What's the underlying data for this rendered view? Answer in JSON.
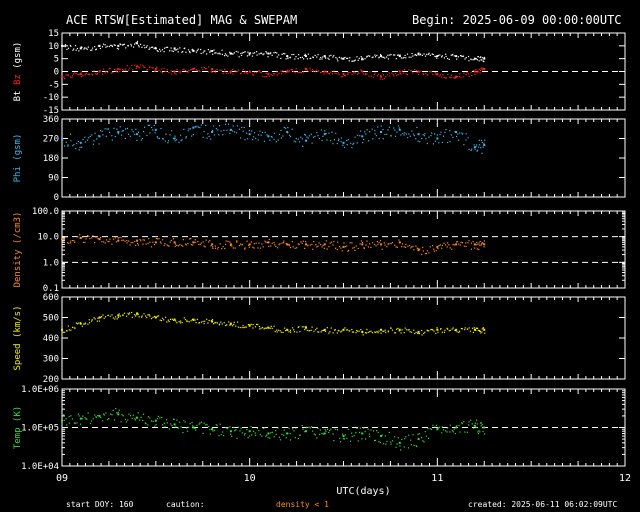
{
  "header": {
    "title": "ACE RTSW[Estimated] MAG & SWEPAM",
    "begin": "Begin: 2025-06-09 00:00:00UTC"
  },
  "footer": {
    "start_doy": "start DOY: 160",
    "caution": "caution:",
    "density_note": "density < 1",
    "created": "created: 2025-06-11 06:02:09UTC"
  },
  "colors": {
    "background": "#000000",
    "frame": "#ffffff",
    "bt": "#ffffff",
    "bz": "#ff2020",
    "phi": "#33bbee",
    "density": "#ff8c1a",
    "speed": "#f4f000",
    "temp": "#33dd33",
    "caution": "#ff8c1a"
  },
  "chart_data": [
    {
      "type": "scatter",
      "title": "ACE RTSW[Estimated] MAG & SWEPAM",
      "ylabel_parts": [
        "Bt",
        "Bz",
        "(gsm)"
      ],
      "ylim": [
        -15,
        15
      ],
      "yticks": [
        -15,
        -10,
        -5,
        0,
        5,
        10,
        15
      ],
      "yticklabels": [
        "-15",
        "-10",
        "-5",
        "0",
        "5",
        "10",
        "15"
      ],
      "reference_lines": [
        0
      ],
      "series": [
        {
          "name": "Bt",
          "color": "#ffffff",
          "x": [
            0,
            0.1,
            0.2,
            0.3,
            0.4,
            0.5,
            0.6,
            0.7,
            0.8,
            0.9,
            1.0,
            1.1,
            1.2,
            1.3,
            1.4,
            1.5,
            1.6,
            1.7,
            1.8,
            1.9,
            2.0,
            2.1,
            2.2,
            2.25
          ],
          "y": [
            10,
            9,
            10,
            10,
            11,
            9,
            9,
            8,
            8,
            7,
            7,
            7,
            6,
            6,
            6,
            5,
            5,
            6,
            6,
            7,
            6,
            6,
            5,
            5
          ]
        },
        {
          "name": "Bz",
          "color": "#ff2020",
          "x": [
            0,
            0.1,
            0.2,
            0.3,
            0.4,
            0.5,
            0.6,
            0.7,
            0.8,
            0.9,
            1.0,
            1.1,
            1.2,
            1.3,
            1.4,
            1.5,
            1.6,
            1.7,
            1.8,
            1.9,
            2.0,
            2.1,
            2.2,
            2.25
          ],
          "y": [
            -2,
            -1,
            0,
            1,
            2,
            1,
            0,
            1,
            1,
            0,
            0,
            -1,
            0,
            1,
            0,
            -1,
            0,
            -2,
            0,
            0,
            -1,
            -2,
            0,
            1
          ]
        }
      ]
    },
    {
      "type": "scatter",
      "ylabel": "Phi (gsm)",
      "ylim": [
        0,
        360
      ],
      "yticks": [
        0,
        90,
        180,
        270,
        360
      ],
      "yticklabels": [
        "0",
        "90",
        "180",
        "270",
        "360"
      ],
      "series": [
        {
          "name": "Phi",
          "color": "#33bbee",
          "x": [
            0,
            0.1,
            0.2,
            0.3,
            0.4,
            0.5,
            0.6,
            0.7,
            0.8,
            0.9,
            1.0,
            1.1,
            1.2,
            1.3,
            1.4,
            1.5,
            1.6,
            1.7,
            1.8,
            1.9,
            2.0,
            2.1,
            2.2,
            2.25
          ],
          "y": [
            270,
            250,
            280,
            300,
            290,
            310,
            270,
            320,
            300,
            310,
            290,
            280,
            300,
            260,
            290,
            250,
            280,
            300,
            310,
            290,
            270,
            300,
            230,
            240
          ]
        }
      ]
    },
    {
      "type": "scatter",
      "ylabel": "Density (/cm3)",
      "yscale": "log",
      "ylim": [
        0.1,
        100
      ],
      "yticks": [
        0.1,
        1,
        10,
        100
      ],
      "yticklabels": [
        "0.1",
        "1.0",
        "10.0",
        "100.0"
      ],
      "reference_lines": [
        10,
        1
      ],
      "series": [
        {
          "name": "Density",
          "color": "#ff8c1a",
          "x": [
            0,
            0.1,
            0.2,
            0.3,
            0.4,
            0.5,
            0.6,
            0.7,
            0.8,
            0.9,
            1.0,
            1.1,
            1.2,
            1.3,
            1.4,
            1.5,
            1.6,
            1.7,
            1.8,
            1.9,
            2.0,
            2.1,
            2.2,
            2.25
          ],
          "y": [
            8,
            9,
            8,
            7,
            7,
            6,
            6,
            6,
            5,
            5,
            5,
            6,
            5,
            5,
            5,
            4,
            5,
            5,
            6,
            3,
            4,
            5,
            5,
            5
          ]
        }
      ]
    },
    {
      "type": "scatter",
      "ylabel": "Speed (km/s)",
      "ylim": [
        200,
        600
      ],
      "yticks": [
        200,
        300,
        400,
        500,
        600
      ],
      "yticklabels": [
        "200",
        "300",
        "400",
        "500",
        "600"
      ],
      "series": [
        {
          "name": "Speed",
          "color": "#f4f000",
          "x": [
            0,
            0.1,
            0.2,
            0.3,
            0.4,
            0.5,
            0.6,
            0.7,
            0.8,
            0.9,
            1.0,
            1.1,
            1.2,
            1.3,
            1.4,
            1.5,
            1.6,
            1.7,
            1.8,
            1.9,
            2.0,
            2.1,
            2.2,
            2.25
          ],
          "y": [
            440,
            470,
            500,
            510,
            520,
            500,
            490,
            490,
            480,
            470,
            460,
            450,
            440,
            450,
            440,
            440,
            430,
            440,
            440,
            430,
            440,
            440,
            440,
            440
          ]
        }
      ]
    },
    {
      "type": "scatter",
      "ylabel": "Temp (K)",
      "yscale": "log",
      "ylim": [
        10000,
        1000000
      ],
      "yticks": [
        10000,
        100000,
        1000000
      ],
      "yticklabels": [
        "1.0E+04",
        "1.0E+05",
        "1.0E+06"
      ],
      "reference_lines": [
        100000
      ],
      "xlabel": "UTC(days)",
      "xlim": [
        9,
        12
      ],
      "xticks": [
        9,
        10,
        11,
        12
      ],
      "xticklabels": [
        "09",
        "10",
        "11",
        "12"
      ],
      "series": [
        {
          "name": "Temp",
          "color": "#33dd33",
          "x": [
            0,
            0.1,
            0.2,
            0.3,
            0.4,
            0.5,
            0.6,
            0.7,
            0.8,
            0.9,
            1.0,
            1.1,
            1.2,
            1.3,
            1.4,
            1.5,
            1.6,
            1.7,
            1.8,
            1.9,
            2.0,
            2.1,
            2.2,
            2.25
          ],
          "y": [
            150000,
            170000,
            200000,
            220000,
            180000,
            150000,
            120000,
            100000,
            90000,
            80000,
            80000,
            70000,
            70000,
            80000,
            70000,
            60000,
            70000,
            60000,
            40000,
            50000,
            90000,
            100000,
            110000,
            100000
          ]
        }
      ]
    }
  ]
}
